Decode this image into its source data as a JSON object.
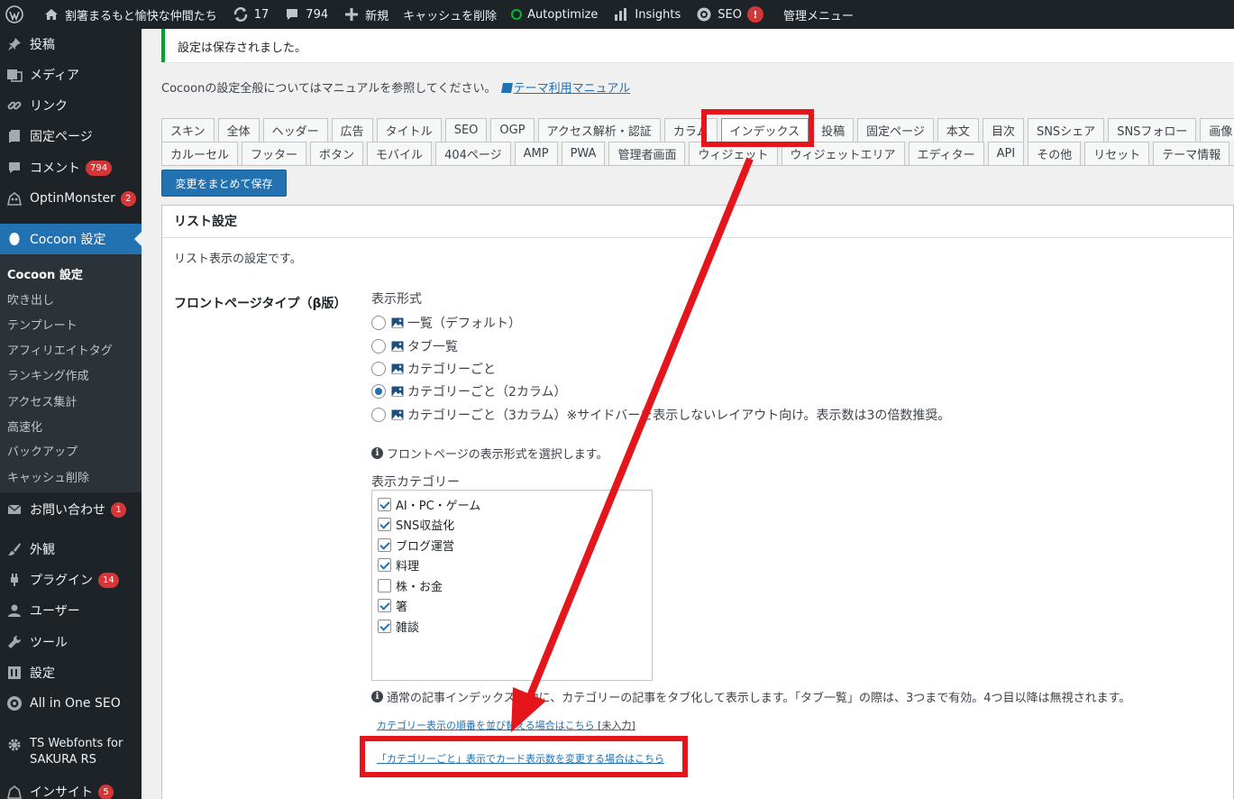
{
  "adminbar": {
    "site_name": "割箸まるもと愉快な仲間たち",
    "updates_count": "17",
    "comments_count": "794",
    "new_label": "新規",
    "cache_label": "キャッシュを削除",
    "autoptimize_label": "Autoptimize",
    "insights_label": "Insights",
    "seo_label": "SEO",
    "seo_badge": "!",
    "admin_menu_label": "管理メニュー"
  },
  "sidebar": {
    "items": [
      {
        "label": "投稿",
        "icon": "pin-icon"
      },
      {
        "label": "メディア",
        "icon": "media-icon"
      },
      {
        "label": "リンク",
        "icon": "link-icon"
      },
      {
        "label": "固定ページ",
        "icon": "page-icon"
      },
      {
        "label": "コメント",
        "icon": "comment-icon",
        "badge": "794"
      },
      {
        "label": "OptinMonster",
        "icon": "monster-icon",
        "badge": "2"
      },
      {
        "label": "Cocoon 設定",
        "icon": "cocoon-icon"
      },
      {
        "label": "お問い合わせ",
        "icon": "mail-icon",
        "badge": "1"
      },
      {
        "label": "外観",
        "icon": "brush-icon"
      },
      {
        "label": "プラグイン",
        "icon": "plugin-icon",
        "badge": "14"
      },
      {
        "label": "ユーザー",
        "icon": "user-icon"
      },
      {
        "label": "ツール",
        "icon": "wrench-icon"
      },
      {
        "label": "設定",
        "icon": "settings-icon"
      },
      {
        "label": "All in One SEO",
        "icon": "aioseo-icon"
      },
      {
        "label_line1": "TS Webfonts for",
        "label_line2": "SAKURA RS",
        "icon": "gear-icon"
      },
      {
        "label": "インサイト",
        "icon": "insights-icon",
        "badge": "5"
      }
    ],
    "submenu": [
      "Cocoon 設定",
      "吹き出し",
      "テンプレート",
      "アフィリエイトタグ",
      "ランキング作成",
      "アクセス集計",
      "高速化",
      "バックアップ",
      "キャッシュ削除"
    ]
  },
  "notice": "設定は保存されました。",
  "manual": {
    "text": "Cocoonの設定全般についてはマニュアルを参照してください。",
    "link": "テーマ利用マニュアル"
  },
  "tabs_row1": [
    "スキン",
    "全体",
    "ヘッダー",
    "広告",
    "タイトル",
    "SEO",
    "OGP",
    "アクセス解析・認証",
    "カラム",
    "インデックス",
    "投稿",
    "固定ページ",
    "本文",
    "目次",
    "SNSシェア",
    "SNSフォロー",
    "画像"
  ],
  "tabs_row2": [
    "カルーセル",
    "フッター",
    "ボタン",
    "モバイル",
    "404ページ",
    "AMP",
    "PWA",
    "管理者画面",
    "ウィジェット",
    "ウィジェットエリア",
    "エディター",
    "API",
    "その他",
    "リセット",
    "テーマ情報"
  ],
  "save_button": "変更をまとめて保存",
  "panel": {
    "title": "リスト設定",
    "description": "リスト表示の設定です。",
    "row_label": "フロントページタイプ（β版）",
    "display_format_label": "表示形式",
    "radios": [
      {
        "label": "一覧（デフォルト）",
        "checked": false
      },
      {
        "label": "タブ一覧",
        "checked": false
      },
      {
        "label": "カテゴリーごと",
        "checked": false
      },
      {
        "label": "カテゴリーごと（2カラム）",
        "checked": true
      },
      {
        "label": "カテゴリーごと（3カラム）※サイドバーを表示しないレイアウト向け。表示数は3の倍数推奨。",
        "checked": false
      }
    ],
    "format_help": "フロントページの表示形式を選択します。",
    "category_label": "表示カテゴリー",
    "categories": [
      {
        "label": "AI・PC・ゲーム",
        "checked": true
      },
      {
        "label": "SNS収益化",
        "checked": true
      },
      {
        "label": "ブログ運営",
        "checked": true
      },
      {
        "label": "料理",
        "checked": true
      },
      {
        "label": "株・お金",
        "checked": false
      },
      {
        "label": "箸",
        "checked": true
      },
      {
        "label": "雑談",
        "checked": true
      }
    ],
    "category_help": "通常の記事インデックスの他に、カテゴリーの記事をタブ化して表示します。「タブ一覧」の際は、3つまで有効。4つ目以降は無視されます。",
    "order_link": "カテゴリー表示の順番を並び替える場合はこちら",
    "order_note": "[未入力]",
    "card_link": "「カテゴリーごと」表示でカード表示数を変更する場合はこちら"
  },
  "colors": {
    "accent": "#2271b1",
    "annotation_red": "#e4161c",
    "admin_dark": "#1d2327"
  }
}
